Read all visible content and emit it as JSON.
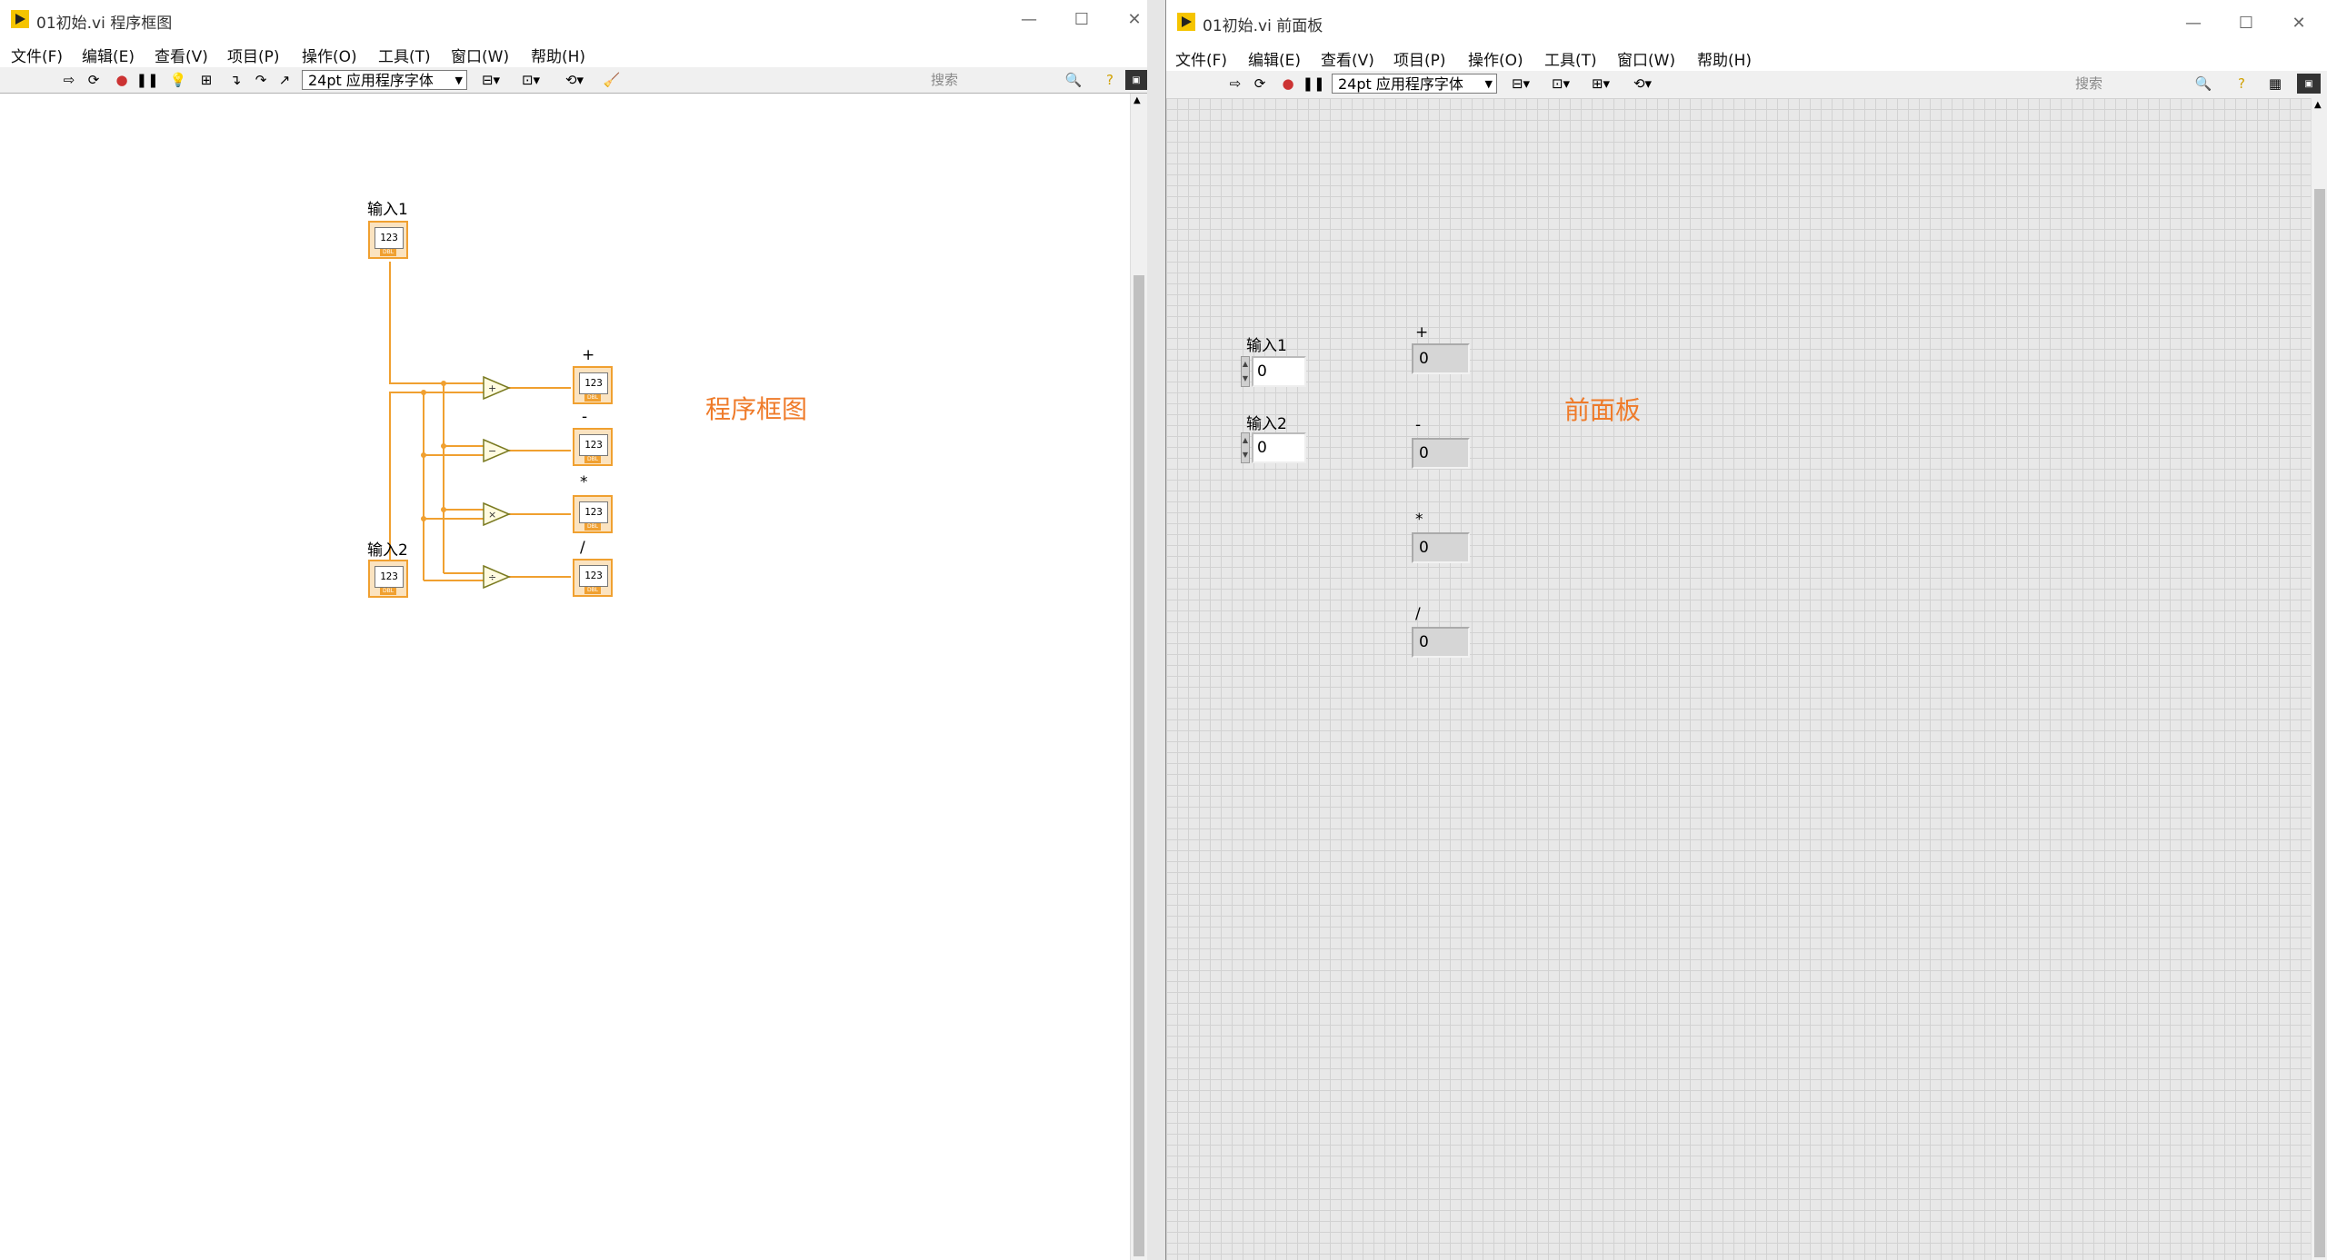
{
  "block_diagram": {
    "title": "01初始.vi 程序框图",
    "menu": [
      "文件(F)",
      "编辑(E)",
      "查看(V)",
      "项目(P)",
      "操作(O)",
      "工具(T)",
      "窗口(W)",
      "帮助(H)"
    ],
    "font_selector": "24pt 应用程序字体",
    "search_placeholder": "搜索",
    "terminals": {
      "input1": "输入1",
      "input2": "输入2",
      "add": "+",
      "sub": "-",
      "mul": "*",
      "div": "/"
    },
    "terminal_text": "123",
    "annotation": "程序框图"
  },
  "front_panel": {
    "title": "01初始.vi 前面板",
    "menu": [
      "文件(F)",
      "编辑(E)",
      "查看(V)",
      "项目(P)",
      "操作(O)",
      "工具(T)",
      "窗口(W)",
      "帮助(H)"
    ],
    "font_selector": "24pt 应用程序字体",
    "search_placeholder": "搜索",
    "controls": [
      {
        "label": "输入1",
        "value": "0"
      },
      {
        "label": "输入2",
        "value": "0"
      }
    ],
    "indicators": [
      {
        "label": "+",
        "value": "0"
      },
      {
        "label": "-",
        "value": "0"
      },
      {
        "label": "*",
        "value": "0"
      },
      {
        "label": "/",
        "value": "0"
      }
    ],
    "annotation": "前面板"
  },
  "window_buttons": {
    "minimize": "—",
    "maximize": "☐",
    "close": "✕"
  },
  "colors": {
    "wire": "#f0a030",
    "annotation": "#ef7b2a",
    "grid": "#d2d2d2",
    "panel_bg": "#e8e8e8"
  }
}
